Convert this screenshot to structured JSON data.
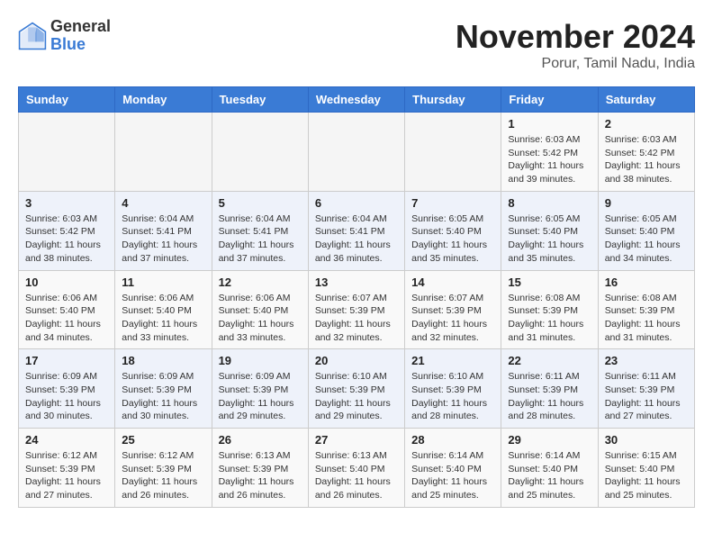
{
  "header": {
    "logo_general": "General",
    "logo_blue": "Blue",
    "month_title": "November 2024",
    "location": "Porur, Tamil Nadu, India"
  },
  "days_of_week": [
    "Sunday",
    "Monday",
    "Tuesday",
    "Wednesday",
    "Thursday",
    "Friday",
    "Saturday"
  ],
  "weeks": [
    [
      {
        "day": "",
        "info": ""
      },
      {
        "day": "",
        "info": ""
      },
      {
        "day": "",
        "info": ""
      },
      {
        "day": "",
        "info": ""
      },
      {
        "day": "",
        "info": ""
      },
      {
        "day": "1",
        "info": "Sunrise: 6:03 AM\nSunset: 5:42 PM\nDaylight: 11 hours and 39 minutes."
      },
      {
        "day": "2",
        "info": "Sunrise: 6:03 AM\nSunset: 5:42 PM\nDaylight: 11 hours and 38 minutes."
      }
    ],
    [
      {
        "day": "3",
        "info": "Sunrise: 6:03 AM\nSunset: 5:42 PM\nDaylight: 11 hours and 38 minutes."
      },
      {
        "day": "4",
        "info": "Sunrise: 6:04 AM\nSunset: 5:41 PM\nDaylight: 11 hours and 37 minutes."
      },
      {
        "day": "5",
        "info": "Sunrise: 6:04 AM\nSunset: 5:41 PM\nDaylight: 11 hours and 37 minutes."
      },
      {
        "day": "6",
        "info": "Sunrise: 6:04 AM\nSunset: 5:41 PM\nDaylight: 11 hours and 36 minutes."
      },
      {
        "day": "7",
        "info": "Sunrise: 6:05 AM\nSunset: 5:40 PM\nDaylight: 11 hours and 35 minutes."
      },
      {
        "day": "8",
        "info": "Sunrise: 6:05 AM\nSunset: 5:40 PM\nDaylight: 11 hours and 35 minutes."
      },
      {
        "day": "9",
        "info": "Sunrise: 6:05 AM\nSunset: 5:40 PM\nDaylight: 11 hours and 34 minutes."
      }
    ],
    [
      {
        "day": "10",
        "info": "Sunrise: 6:06 AM\nSunset: 5:40 PM\nDaylight: 11 hours and 34 minutes."
      },
      {
        "day": "11",
        "info": "Sunrise: 6:06 AM\nSunset: 5:40 PM\nDaylight: 11 hours and 33 minutes."
      },
      {
        "day": "12",
        "info": "Sunrise: 6:06 AM\nSunset: 5:40 PM\nDaylight: 11 hours and 33 minutes."
      },
      {
        "day": "13",
        "info": "Sunrise: 6:07 AM\nSunset: 5:39 PM\nDaylight: 11 hours and 32 minutes."
      },
      {
        "day": "14",
        "info": "Sunrise: 6:07 AM\nSunset: 5:39 PM\nDaylight: 11 hours and 32 minutes."
      },
      {
        "day": "15",
        "info": "Sunrise: 6:08 AM\nSunset: 5:39 PM\nDaylight: 11 hours and 31 minutes."
      },
      {
        "day": "16",
        "info": "Sunrise: 6:08 AM\nSunset: 5:39 PM\nDaylight: 11 hours and 31 minutes."
      }
    ],
    [
      {
        "day": "17",
        "info": "Sunrise: 6:09 AM\nSunset: 5:39 PM\nDaylight: 11 hours and 30 minutes."
      },
      {
        "day": "18",
        "info": "Sunrise: 6:09 AM\nSunset: 5:39 PM\nDaylight: 11 hours and 30 minutes."
      },
      {
        "day": "19",
        "info": "Sunrise: 6:09 AM\nSunset: 5:39 PM\nDaylight: 11 hours and 29 minutes."
      },
      {
        "day": "20",
        "info": "Sunrise: 6:10 AM\nSunset: 5:39 PM\nDaylight: 11 hours and 29 minutes."
      },
      {
        "day": "21",
        "info": "Sunrise: 6:10 AM\nSunset: 5:39 PM\nDaylight: 11 hours and 28 minutes."
      },
      {
        "day": "22",
        "info": "Sunrise: 6:11 AM\nSunset: 5:39 PM\nDaylight: 11 hours and 28 minutes."
      },
      {
        "day": "23",
        "info": "Sunrise: 6:11 AM\nSunset: 5:39 PM\nDaylight: 11 hours and 27 minutes."
      }
    ],
    [
      {
        "day": "24",
        "info": "Sunrise: 6:12 AM\nSunset: 5:39 PM\nDaylight: 11 hours and 27 minutes."
      },
      {
        "day": "25",
        "info": "Sunrise: 6:12 AM\nSunset: 5:39 PM\nDaylight: 11 hours and 26 minutes."
      },
      {
        "day": "26",
        "info": "Sunrise: 6:13 AM\nSunset: 5:39 PM\nDaylight: 11 hours and 26 minutes."
      },
      {
        "day": "27",
        "info": "Sunrise: 6:13 AM\nSunset: 5:40 PM\nDaylight: 11 hours and 26 minutes."
      },
      {
        "day": "28",
        "info": "Sunrise: 6:14 AM\nSunset: 5:40 PM\nDaylight: 11 hours and 25 minutes."
      },
      {
        "day": "29",
        "info": "Sunrise: 6:14 AM\nSunset: 5:40 PM\nDaylight: 11 hours and 25 minutes."
      },
      {
        "day": "30",
        "info": "Sunrise: 6:15 AM\nSunset: 5:40 PM\nDaylight: 11 hours and 25 minutes."
      }
    ]
  ]
}
